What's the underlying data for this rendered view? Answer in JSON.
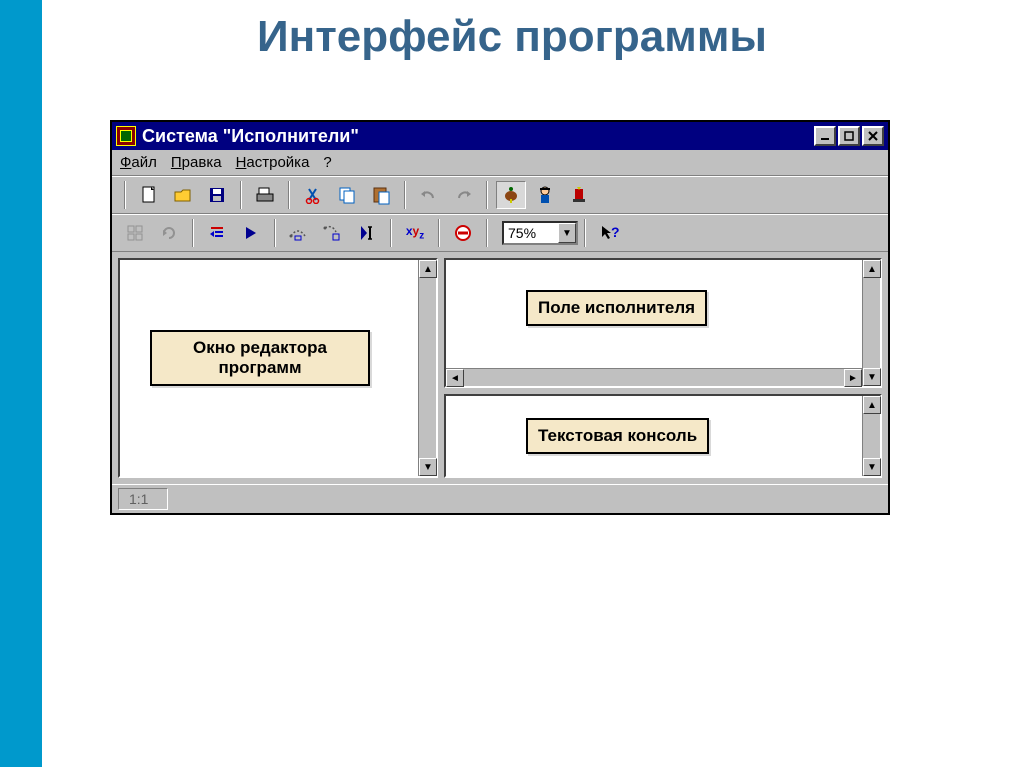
{
  "slide": {
    "title": "Интерфейс программы"
  },
  "window": {
    "title": "Система \"Исполнители\"",
    "menus": {
      "file": "Файл",
      "edit": "Правка",
      "setup": "Настройка",
      "help": "?"
    },
    "zoom": "75%",
    "status": "1:1"
  },
  "callouts": {
    "editor": "Окно редактора программ",
    "field": "Поле исполнителя",
    "console": "Текстовая консоль"
  },
  "icons": {
    "new": "new",
    "open": "open",
    "save": "save",
    "print": "print",
    "cut": "cut",
    "copy": "copy",
    "paste": "paste",
    "undo": "undo",
    "redo": "redo",
    "executor1": "turtle",
    "executor2": "robot",
    "executor3": "drafter",
    "grid": "grid",
    "refresh": "refresh",
    "indent": "indent",
    "run": "run",
    "stepover": "stepover",
    "stepinto": "stepinto",
    "cursor": "cursor",
    "vars": "xyz",
    "stop": "stop",
    "pointerhelp": "pointer-help"
  }
}
